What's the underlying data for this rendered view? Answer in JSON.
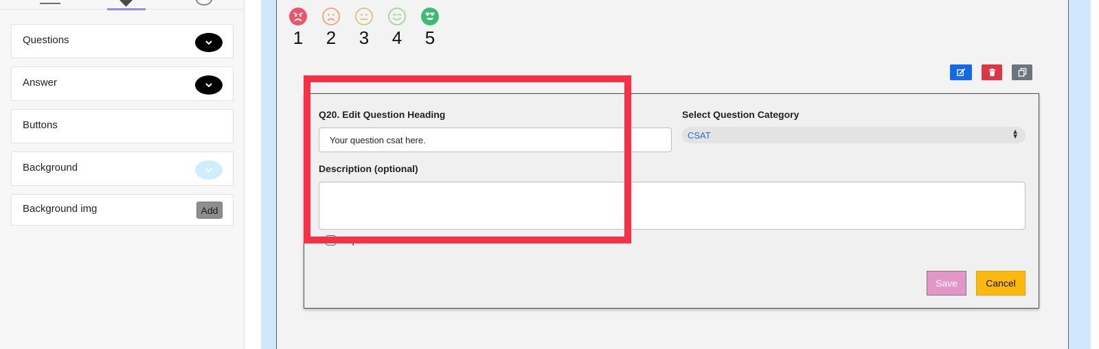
{
  "sidebar": {
    "sections": [
      {
        "label": "Questions",
        "control": "chevron",
        "control_color": "#000000"
      },
      {
        "label": "Answer",
        "control": "chevron",
        "control_color": "#000000"
      },
      {
        "label": "Buttons",
        "control": "none"
      },
      {
        "label": "Background",
        "control": "chevron",
        "control_color": "#cfeefd"
      },
      {
        "label": "Background img",
        "control": "button",
        "button_label": "Add"
      }
    ]
  },
  "ratings": [
    {
      "value": "1",
      "icon": "angry-face-icon",
      "color": "#e9556a"
    },
    {
      "value": "2",
      "icon": "frowning-face-icon",
      "color": "#f0a37a"
    },
    {
      "value": "3",
      "icon": "neutral-face-icon",
      "color": "#d9c27a"
    },
    {
      "value": "4",
      "icon": "smiling-face-icon",
      "color": "#9fd49a"
    },
    {
      "value": "5",
      "icon": "heart-eyes-face-icon",
      "color": "#3dbb73"
    }
  ],
  "toolbar": {
    "edit_icon": "edit-icon",
    "edit_color": "#1469e6",
    "delete_icon": "trash-icon",
    "delete_color": "#dc3545",
    "copy_icon": "copy-icon",
    "copy_color": "#6c757d"
  },
  "editor": {
    "heading_label": "Q20. Edit Question Heading",
    "heading_value": "Your question csat here.",
    "category_label": "Select Question Category",
    "category_value": "CSAT",
    "description_label": "Description (optional)",
    "description_value": "",
    "require_label": "Require",
    "require_checked": false,
    "save_label": "Save",
    "cancel_label": "Cancel"
  },
  "colors": {
    "highlight": "#f72f47",
    "canvas_bg": "#cfe9fb",
    "save_bg": "#e596c9",
    "cancel_bg": "#fbb90f"
  }
}
